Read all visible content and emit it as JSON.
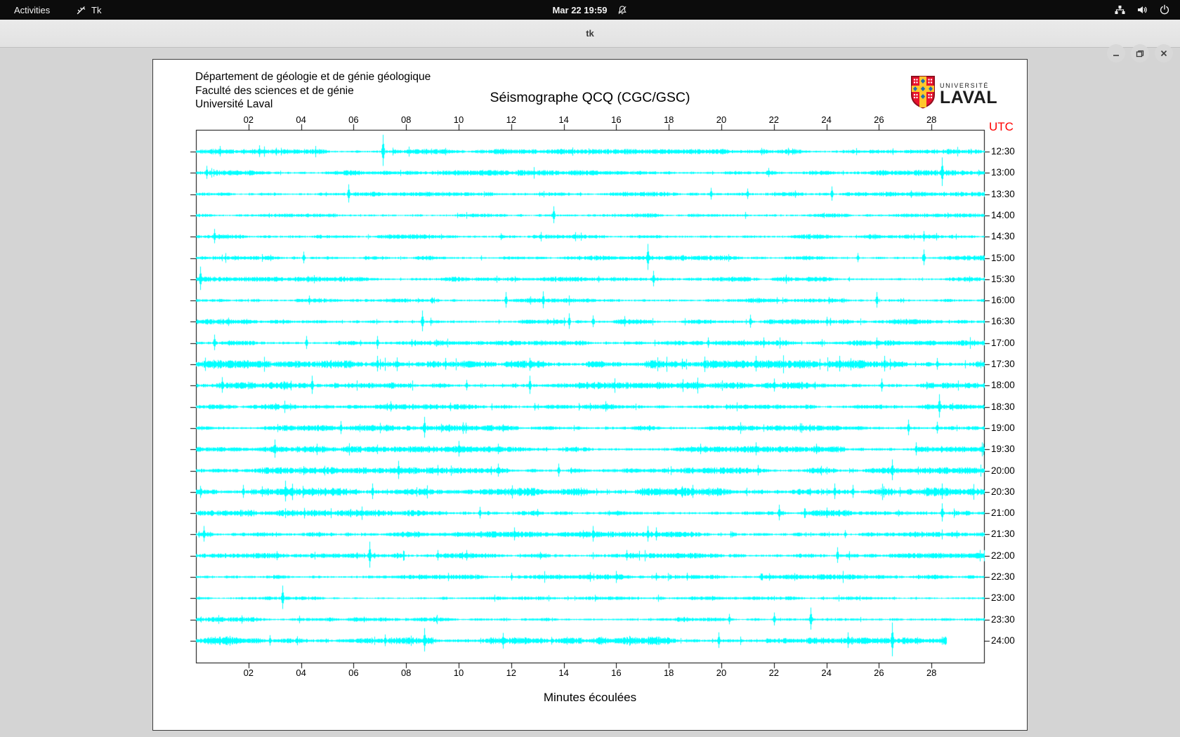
{
  "topbar": {
    "activities_label": "Activities",
    "app_name": "Tk",
    "clock": "Mar 22 19:59",
    "icon_names": [
      "tk-app-icon",
      "notifications-muted-icon",
      "network-wired-icon",
      "volume-icon",
      "power-icon"
    ]
  },
  "titlebar": {
    "title": "tk",
    "buttons": [
      "minimize",
      "maximize",
      "close"
    ]
  },
  "page": {
    "header_lines": [
      "Département de géologie et de génie géologique",
      "Faculté des sciences et de génie",
      "Université Laval"
    ],
    "title": "Séismographe QCQ (CGC/GSC)",
    "logo_line1": "UNIVERSITÉ",
    "logo_line2": "LAVAL"
  },
  "chart_data": {
    "type": "line",
    "subtype": "helicorder-seismogram",
    "title": "Séismographe QCQ (CGC/GSC)",
    "xlabel": "Minutes écoulées",
    "right_axis_label": "UTC",
    "x_range_minutes": [
      0,
      30
    ],
    "x_ticks": [
      "02",
      "04",
      "06",
      "08",
      "10",
      "12",
      "14",
      "16",
      "18",
      "20",
      "22",
      "24",
      "26",
      "28"
    ],
    "trace_color": "#00ffff",
    "utc_color": "#ff0000",
    "rows": [
      {
        "label": "12:30",
        "noise": 1.6,
        "extent": 1,
        "events": [
          [
            0.9,
            8
          ],
          [
            2.4,
            9
          ],
          [
            7.1,
            24
          ]
        ]
      },
      {
        "label": "13:00",
        "noise": 1.7,
        "extent": 1,
        "events": [
          [
            0.4,
            10
          ],
          [
            21.8,
            7
          ],
          [
            28.4,
            22
          ]
        ]
      },
      {
        "label": "13:30",
        "noise": 1.4,
        "extent": 1,
        "events": [
          [
            5.8,
            14
          ],
          [
            19.6,
            9
          ],
          [
            21.0,
            8
          ],
          [
            24.2,
            11
          ]
        ]
      },
      {
        "label": "14:00",
        "noise": 1.3,
        "extent": 1,
        "events": [
          [
            13.6,
            13
          ]
        ]
      },
      {
        "label": "14:30",
        "noise": 1.5,
        "extent": 1,
        "events": [
          [
            0.7,
            11
          ],
          [
            27.7,
            8
          ]
        ]
      },
      {
        "label": "15:00",
        "noise": 1.5,
        "extent": 1,
        "events": [
          [
            4.1,
            9
          ],
          [
            17.2,
            20
          ],
          [
            25.2,
            7
          ],
          [
            27.7,
            12
          ]
        ]
      },
      {
        "label": "15:30",
        "noise": 1.5,
        "extent": 1,
        "events": [
          [
            0.15,
            18
          ],
          [
            17.4,
            12
          ]
        ]
      },
      {
        "label": "16:00",
        "noise": 1.6,
        "extent": 1,
        "events": [
          [
            4.3,
            7
          ],
          [
            11.8,
            12
          ],
          [
            13.2,
            13
          ],
          [
            25.9,
            12
          ]
        ]
      },
      {
        "label": "16:30",
        "noise": 1.7,
        "extent": 1,
        "events": [
          [
            8.6,
            16
          ],
          [
            14.2,
            12
          ],
          [
            15.1,
            9
          ],
          [
            16.3,
            8
          ],
          [
            21.1,
            10
          ],
          [
            24.0,
            7
          ]
        ]
      },
      {
        "label": "17:00",
        "noise": 1.6,
        "extent": 1,
        "events": [
          [
            0.7,
            12
          ],
          [
            4.2,
            10
          ],
          [
            6.9,
            10
          ],
          [
            19.5,
            8
          ],
          [
            21.6,
            8
          ]
        ]
      },
      {
        "label": "17:30",
        "noise": 2.6,
        "extent": 1,
        "events": [
          [
            6.9,
            12
          ],
          [
            9.5,
            9
          ],
          [
            18.5,
            8
          ],
          [
            21.3,
            12
          ],
          [
            24.5,
            12
          ],
          [
            26.2,
            12
          ],
          [
            28.2,
            9
          ]
        ]
      },
      {
        "label": "18:00",
        "noise": 2.2,
        "extent": 1,
        "events": [
          [
            1.0,
            12
          ],
          [
            4.4,
            14
          ],
          [
            10.3,
            8
          ],
          [
            12.7,
            14
          ],
          [
            22.0,
            10
          ],
          [
            26.1,
            10
          ]
        ]
      },
      {
        "label": "18:30",
        "noise": 1.6,
        "extent": 1,
        "events": [
          [
            7.4,
            8
          ],
          [
            15.6,
            8
          ],
          [
            28.3,
            18
          ]
        ]
      },
      {
        "label": "19:00",
        "noise": 1.8,
        "extent": 1,
        "events": [
          [
            5.5,
            10
          ],
          [
            8.7,
            16
          ],
          [
            23.0,
            7
          ],
          [
            27.1,
            12
          ],
          [
            28.2,
            9
          ]
        ]
      },
      {
        "label": "19:30",
        "noise": 2.0,
        "extent": 1,
        "events": [
          [
            3.0,
            14
          ],
          [
            10.0,
            12
          ],
          [
            11.5,
            8
          ],
          [
            19.2,
            8
          ],
          [
            21.3,
            10
          ],
          [
            23.6,
            8
          ],
          [
            27.4,
            10
          ]
        ]
      },
      {
        "label": "20:00",
        "noise": 2.0,
        "extent": 1,
        "events": [
          [
            7.7,
            14
          ],
          [
            9.2,
            8
          ],
          [
            11.5,
            10
          ],
          [
            13.8,
            10
          ],
          [
            21.4,
            8
          ],
          [
            26.5,
            16
          ]
        ]
      },
      {
        "label": "20:30",
        "noise": 2.6,
        "extent": 1,
        "events": [
          [
            1.8,
            10
          ],
          [
            2.5,
            8
          ],
          [
            3.4,
            16
          ],
          [
            6.7,
            12
          ],
          [
            18.9,
            10
          ],
          [
            24.3,
            12
          ],
          [
            25.0,
            10
          ],
          [
            28.4,
            12
          ]
        ]
      },
      {
        "label": "21:00",
        "noise": 2.0,
        "extent": 1,
        "events": [
          [
            10.8,
            9
          ],
          [
            13.0,
            6
          ],
          [
            22.2,
            12
          ],
          [
            24.0,
            8
          ],
          [
            28.4,
            14
          ]
        ]
      },
      {
        "label": "21:30",
        "noise": 1.8,
        "extent": 1,
        "events": [
          [
            0.3,
            12
          ],
          [
            12.1,
            10
          ],
          [
            15.1,
            12
          ],
          [
            17.2,
            12
          ],
          [
            17.5,
            10
          ],
          [
            24.7,
            6
          ]
        ]
      },
      {
        "label": "22:00",
        "noise": 1.7,
        "extent": 1,
        "events": [
          [
            6.6,
            20
          ],
          [
            9.2,
            8
          ],
          [
            10.3,
            8
          ],
          [
            16.4,
            8
          ],
          [
            24.4,
            12
          ]
        ]
      },
      {
        "label": "22:30",
        "noise": 1.6,
        "extent": 1,
        "events": [
          [
            12.0,
            6
          ],
          [
            17.5,
            6
          ],
          [
            18.7,
            6
          ],
          [
            21.5,
            5
          ]
        ]
      },
      {
        "label": "23:00",
        "noise": 1.1,
        "extent": 1,
        "events": [
          [
            3.3,
            18
          ]
        ]
      },
      {
        "label": "23:30",
        "noise": 1.4,
        "extent": 1,
        "events": [
          [
            20.3,
            8
          ],
          [
            22.0,
            10
          ],
          [
            23.4,
            17
          ]
        ]
      },
      {
        "label": "24:00",
        "noise": 2.4,
        "extent": 0.952,
        "events": [
          [
            2.8,
            8
          ],
          [
            7.2,
            9
          ],
          [
            8.7,
            18
          ],
          [
            19.9,
            12
          ],
          [
            24.8,
            12
          ],
          [
            26.5,
            26
          ]
        ]
      }
    ]
  }
}
